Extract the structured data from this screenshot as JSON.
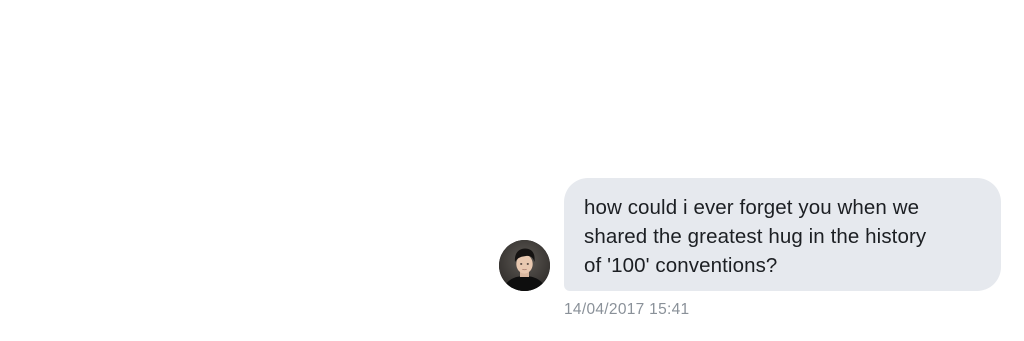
{
  "conversation": {
    "message": {
      "lines": [
        "how could i ever forget you when we",
        "shared the greatest hug in the history",
        "of '100' conventions?"
      ],
      "timestamp": "14/04/2017 15:41",
      "bubble_color": "#e6e9ee",
      "text_color": "#1c1f23"
    },
    "sender": {
      "avatar_icon": "user-avatar-photo"
    }
  },
  "page": {
    "background": "#ffffff",
    "timestamp_color": "#8a9199"
  }
}
